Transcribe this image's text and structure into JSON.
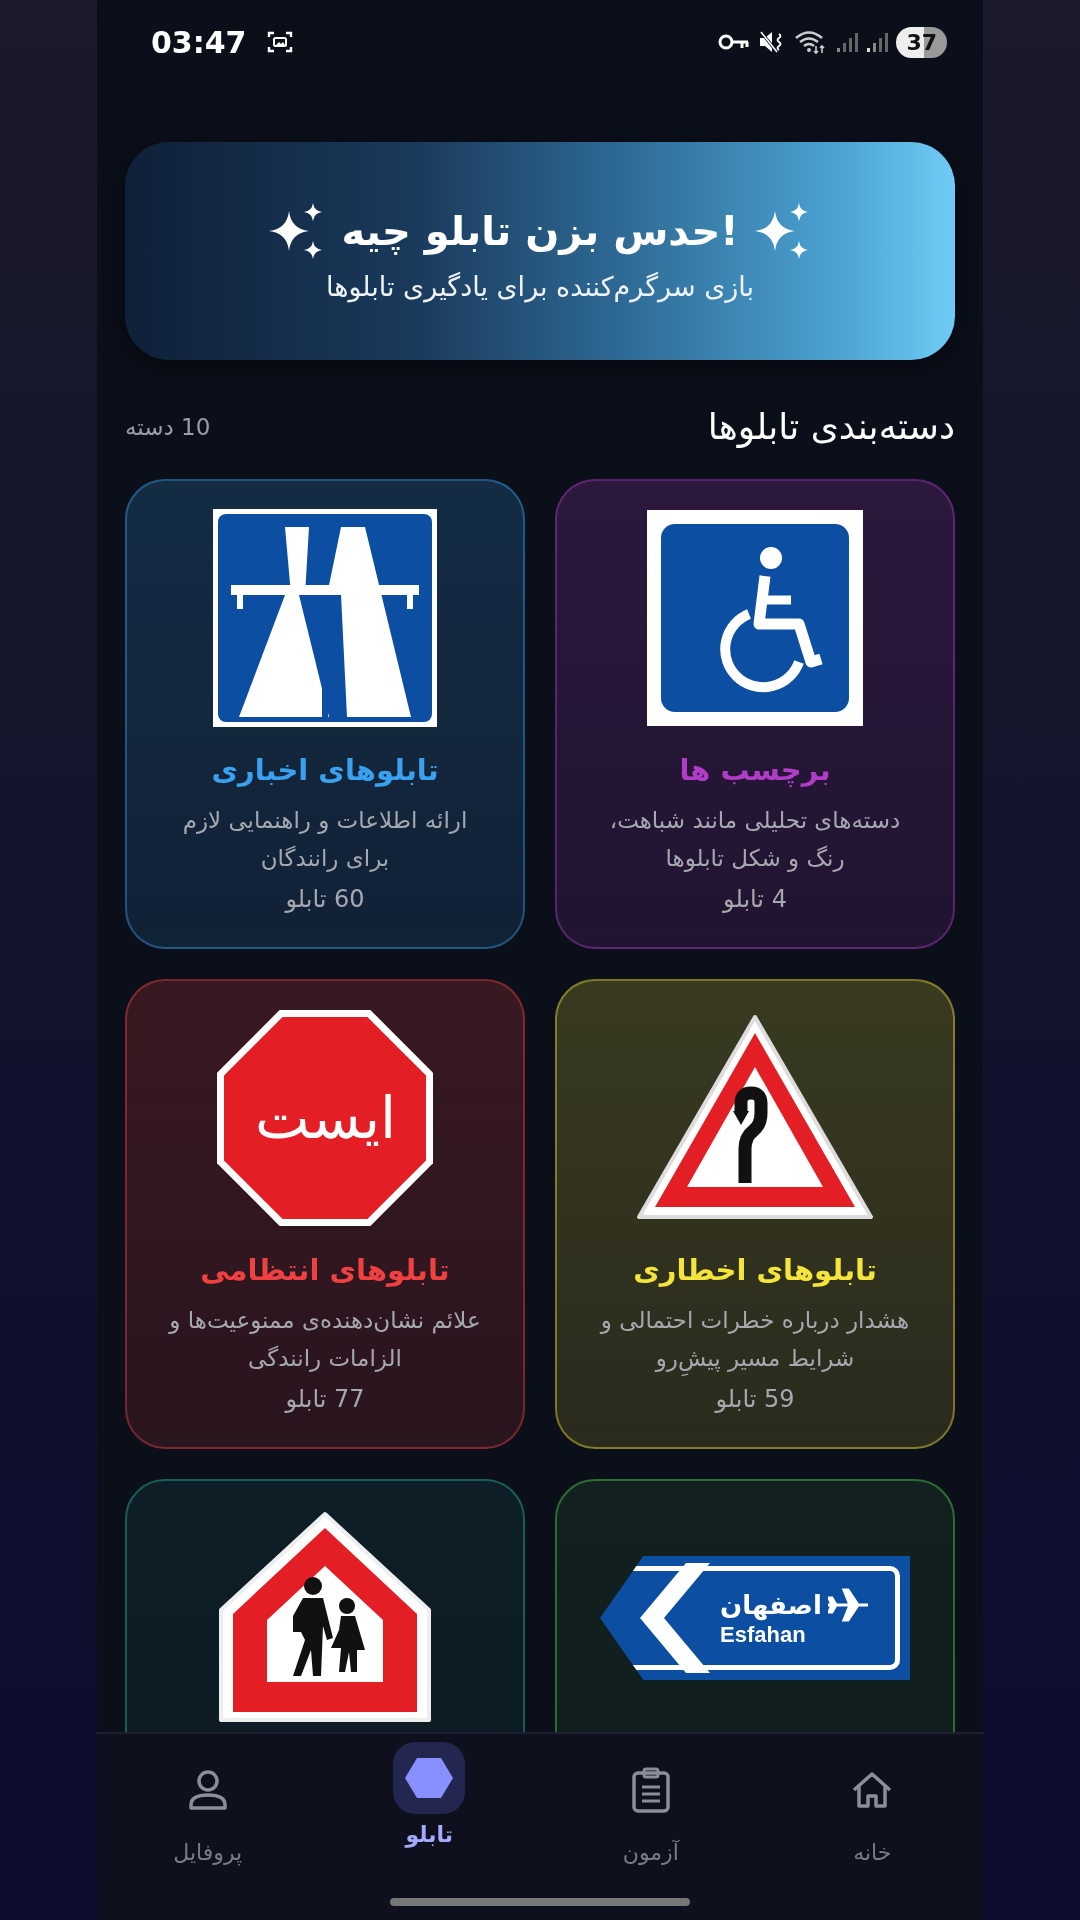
{
  "status_bar": {
    "time": "03:47",
    "battery": "37"
  },
  "banner": {
    "title": "!حدس بزن تابلو چیه",
    "subtitle": "بازی سرگرم‌کننده برای یادگیری تابلوها"
  },
  "section": {
    "title": "دسته‌بندی تابلوها",
    "count": "10 دسته"
  },
  "categories": [
    {
      "kind": "wheelchair",
      "color": "#b03cc8",
      "title": "برچسب ها",
      "description": "دسته‌های تحلیلی مانند شباهت، رنگ و شکل تابلوها",
      "count": "4 تابلو"
    },
    {
      "kind": "motorway",
      "color": "#3aa0f0",
      "title": "تابلوهای اخباری",
      "description": "ارائه اطلاعات و راهنمایی لازم برای رانندگان",
      "count": "60 تابلو"
    },
    {
      "kind": "curve",
      "color": "#f5e53a",
      "title": "تابلوهای اخطاری",
      "description": "هشدار درباره خطرات احتمالی و شرایط مسیر پیشِ‌رو",
      "count": "59 تابلو"
    },
    {
      "kind": "stop",
      "color": "#f04040",
      "title": "تابلوهای انتظامی",
      "description": "علائم نشان‌دهنده‌ی ممنوعیت‌ها و الزامات رانندگی",
      "count": "77 تابلو",
      "sign_text": "ایست"
    },
    {
      "kind": "direction",
      "color": "#2e6a34",
      "sign_text": "اصفهان",
      "sign_subtext": "Esfahan"
    },
    {
      "kind": "school",
      "color": "#1a5c58"
    }
  ],
  "nav": [
    {
      "kind": "home",
      "label": "خانه",
      "selected": false
    },
    {
      "kind": "quiz",
      "label": "آزمون",
      "selected": false
    },
    {
      "kind": "signs",
      "label": "تابلو",
      "selected": true
    },
    {
      "kind": "profile",
      "label": "پروفایل",
      "selected": false
    }
  ]
}
